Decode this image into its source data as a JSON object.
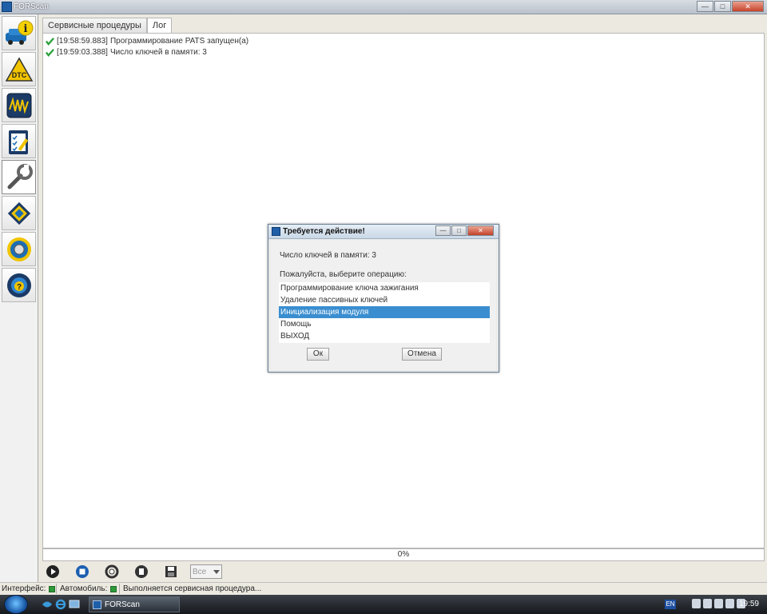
{
  "app": {
    "title": "FORScan"
  },
  "window_buttons": {
    "minimize": "—",
    "maximize": "□",
    "close": "✕"
  },
  "sidebar": {
    "items": [
      {
        "name": "vehicle-info",
        "icon": "info-car-icon"
      },
      {
        "name": "dtc",
        "icon": "dtc-warning-icon",
        "label": "DTC"
      },
      {
        "name": "oscilloscope",
        "icon": "oscilloscope-icon"
      },
      {
        "name": "tests",
        "icon": "checklist-icon"
      },
      {
        "name": "service",
        "icon": "wrench-icon",
        "active": true
      },
      {
        "name": "configuration",
        "icon": "chip-icon"
      },
      {
        "name": "settings",
        "icon": "gear-icon"
      },
      {
        "name": "help",
        "icon": "help-steering-icon"
      }
    ]
  },
  "tabs": [
    {
      "label": "Сервисные процедуры",
      "active": false
    },
    {
      "label": "Лог",
      "active": true
    }
  ],
  "log": [
    {
      "time": "[19:58:59.883]",
      "text": "Программирование PATS запущен(а)"
    },
    {
      "time": "[19:59:03.388]",
      "text": "Число ключей в памяти: 3"
    }
  ],
  "progress": {
    "value": 0,
    "label": "0%"
  },
  "toolbar": {
    "filter_value": "Все"
  },
  "statusbar": {
    "interface_label": "Интерфейс:",
    "vehicle_label": "Автомобиль:",
    "status_text": "Выполняется сервисная процедура..."
  },
  "dialog": {
    "title": "Требуется действие!",
    "keys_text": "Число ключей в памяти: 3",
    "prompt": "Пожалуйста, выберите операцию:",
    "options": [
      {
        "label": "Программирование ключа зажигания",
        "selected": false
      },
      {
        "label": "Удаление пассивных ключей",
        "selected": false
      },
      {
        "label": "Инициализация модуля",
        "selected": true
      },
      {
        "label": "Помощь",
        "selected": false
      },
      {
        "label": "ВЫХОД",
        "selected": false
      }
    ],
    "ok_label": "Ок",
    "cancel_label": "Отмена"
  },
  "taskbar": {
    "task_label": "FORScan",
    "language": "EN",
    "clock": "19:59"
  },
  "colors": {
    "selection": "#3a8ed0",
    "ok_led": "#2e9a3a",
    "check": "#2aa03a"
  }
}
